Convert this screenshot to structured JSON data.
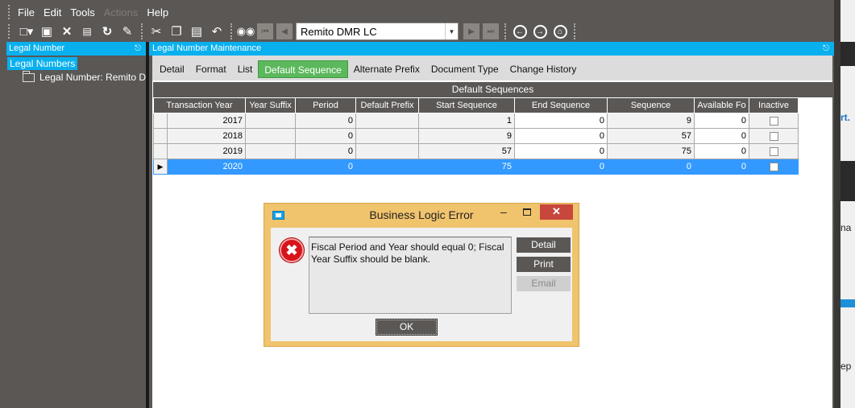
{
  "menubar": {
    "items": [
      {
        "label": "File",
        "enabled": true
      },
      {
        "label": "Edit",
        "enabled": true
      },
      {
        "label": "Tools",
        "enabled": true
      },
      {
        "label": "Actions",
        "enabled": false
      },
      {
        "label": "Help",
        "enabled": true
      }
    ]
  },
  "toolbar": {
    "company": "Remito DMR LC"
  },
  "tree": {
    "header": "Legal Number",
    "root_label": "Legal Numbers",
    "child_label": "Legal Number: Remito D"
  },
  "main": {
    "header": "Legal Number Maintenance",
    "tabs": [
      {
        "label": "Detail",
        "active": false
      },
      {
        "label": "Format",
        "active": false
      },
      {
        "label": "List",
        "active": false
      },
      {
        "label": "Default Sequence",
        "active": true
      },
      {
        "label": "Alternate Prefix",
        "active": false
      },
      {
        "label": "Document Type",
        "active": false
      },
      {
        "label": "Change History",
        "active": false
      }
    ],
    "grid": {
      "caption": "Default Sequences",
      "columns": [
        "Transaction Year",
        "Year Suffix",
        "Period",
        "Default Prefix",
        "Start Sequence",
        "End Sequence",
        "Sequence",
        "Available Fo",
        "Inactive"
      ],
      "rows": [
        {
          "year": "2017",
          "suffix": "",
          "period": "0",
          "prefix": "",
          "start": "1",
          "end": "0",
          "sequence": "9",
          "available": "0",
          "inactive": false,
          "selected": false
        },
        {
          "year": "2018",
          "suffix": "",
          "period": "0",
          "prefix": "",
          "start": "9",
          "end": "0",
          "sequence": "57",
          "available": "0",
          "inactive": false,
          "selected": false
        },
        {
          "year": "2019",
          "suffix": "",
          "period": "0",
          "prefix": "",
          "start": "57",
          "end": "0",
          "sequence": "75",
          "available": "0",
          "inactive": false,
          "selected": false
        },
        {
          "year": "2020",
          "suffix": "",
          "period": "0",
          "prefix": "",
          "start": "75",
          "end": "0",
          "sequence": "0",
          "available": "0",
          "inactive": false,
          "selected": true
        }
      ]
    }
  },
  "dialog": {
    "title": "Business Logic Error",
    "message": "Fiscal Period and Year should equal 0; Fiscal Year Suffix should be blank.",
    "buttons": {
      "detail": "Detail",
      "print": "Print",
      "email": "Email",
      "ok": "OK"
    }
  },
  "background_window": {
    "fragments": [
      "rt.",
      "na",
      "ep"
    ]
  }
}
